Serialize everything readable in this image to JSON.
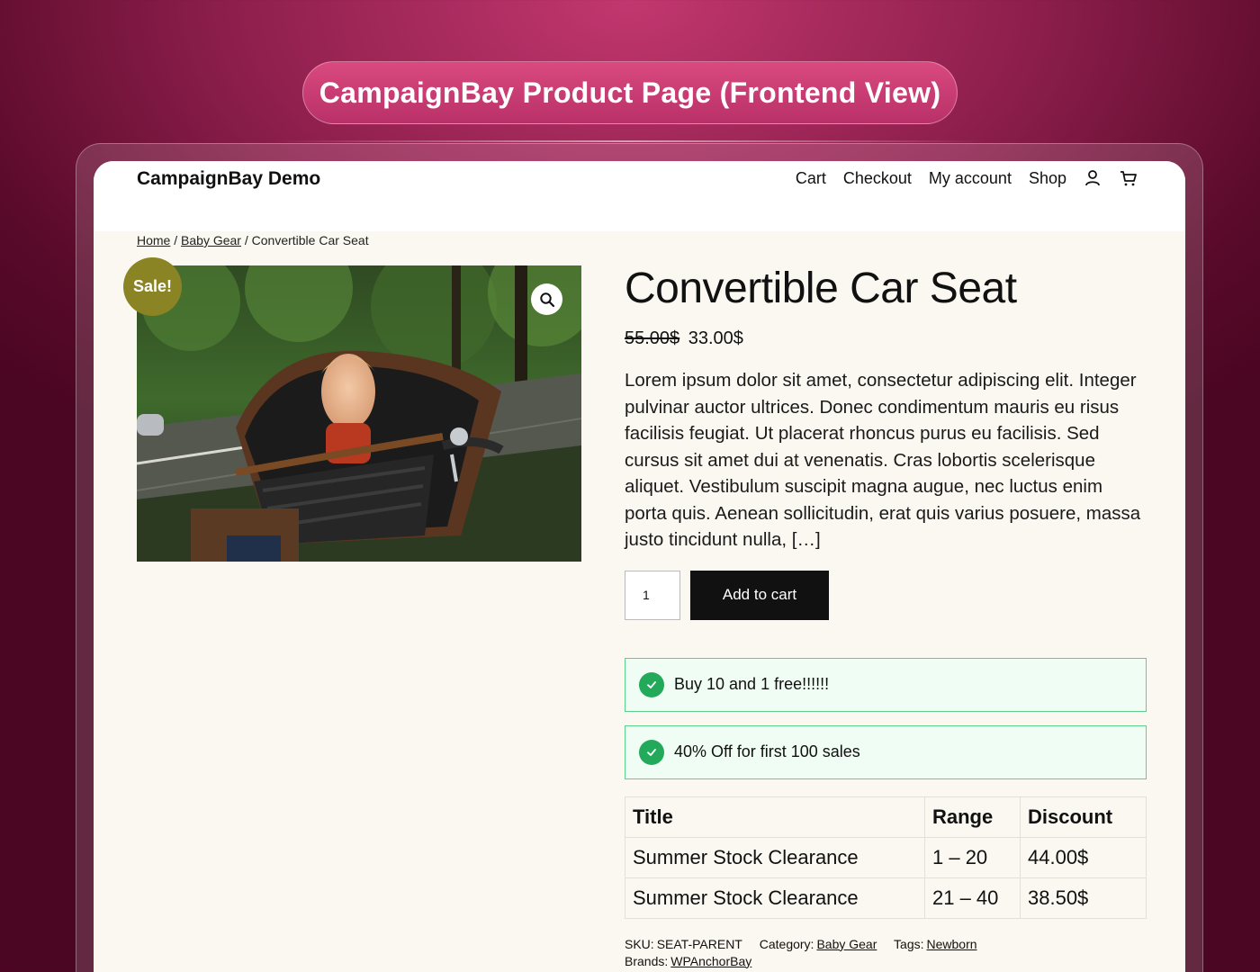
{
  "banner": {
    "title": "CampaignBay Product Page (Frontend View)"
  },
  "header": {
    "site_title": "CampaignBay Demo",
    "nav": [
      "Cart",
      "Checkout",
      "My account",
      "Shop"
    ],
    "icons": [
      "account-icon",
      "cart-icon"
    ]
  },
  "breadcrumb": {
    "home": "Home",
    "sep": "/",
    "category": "Baby Gear",
    "current": "Convertible Car Seat"
  },
  "gallery": {
    "sale_badge": "Sale!",
    "zoom_icon": "magnifier-icon"
  },
  "product": {
    "title": "Convertible Car Seat",
    "regular_price": "55.00$",
    "sale_price": "33.00$",
    "description": "Lorem ipsum dolor sit amet, consectetur adipiscing elit. Integer pulvinar auctor ultrices. Donec condimentum mauris eu risus facilisis feugiat. Ut placerat rhoncus purus eu facilisis. Sed cursus sit amet dui at venenatis. Cras lobortis scelerisque aliquet. Vestibulum suscipit magna augue, nec luctus enim porta quis. Aenean sollicitudin, erat quis varius posuere, massa justo tincidunt nulla, […]",
    "quantity": "1",
    "add_to_cart": "Add to cart"
  },
  "notices": [
    {
      "text": "Buy 10 and 1 free!!!!!!"
    },
    {
      "text": "40% Off for first 100 sales"
    }
  ],
  "tiers": {
    "headers": [
      "Title",
      "Range",
      "Discount"
    ],
    "rows": [
      [
        "Summer Stock Clearance",
        "1 – 20",
        "44.00$"
      ],
      [
        "Summer Stock Clearance",
        "21 – 40",
        "38.50$"
      ]
    ]
  },
  "meta": {
    "sku_label": "SKU:",
    "sku": "SEAT-PARENT",
    "category_label": "Category:",
    "category": "Baby Gear",
    "tags_label": "Tags:",
    "tags": "Newborn",
    "brands_label": "Brands:",
    "brands": "WPAnchorBay"
  },
  "colors": {
    "accent_sale": "#8a8424",
    "notice_border": "#5fcf8c",
    "notice_bg": "#f0fdf4",
    "check": "#22a95a",
    "button": "#111111"
  }
}
